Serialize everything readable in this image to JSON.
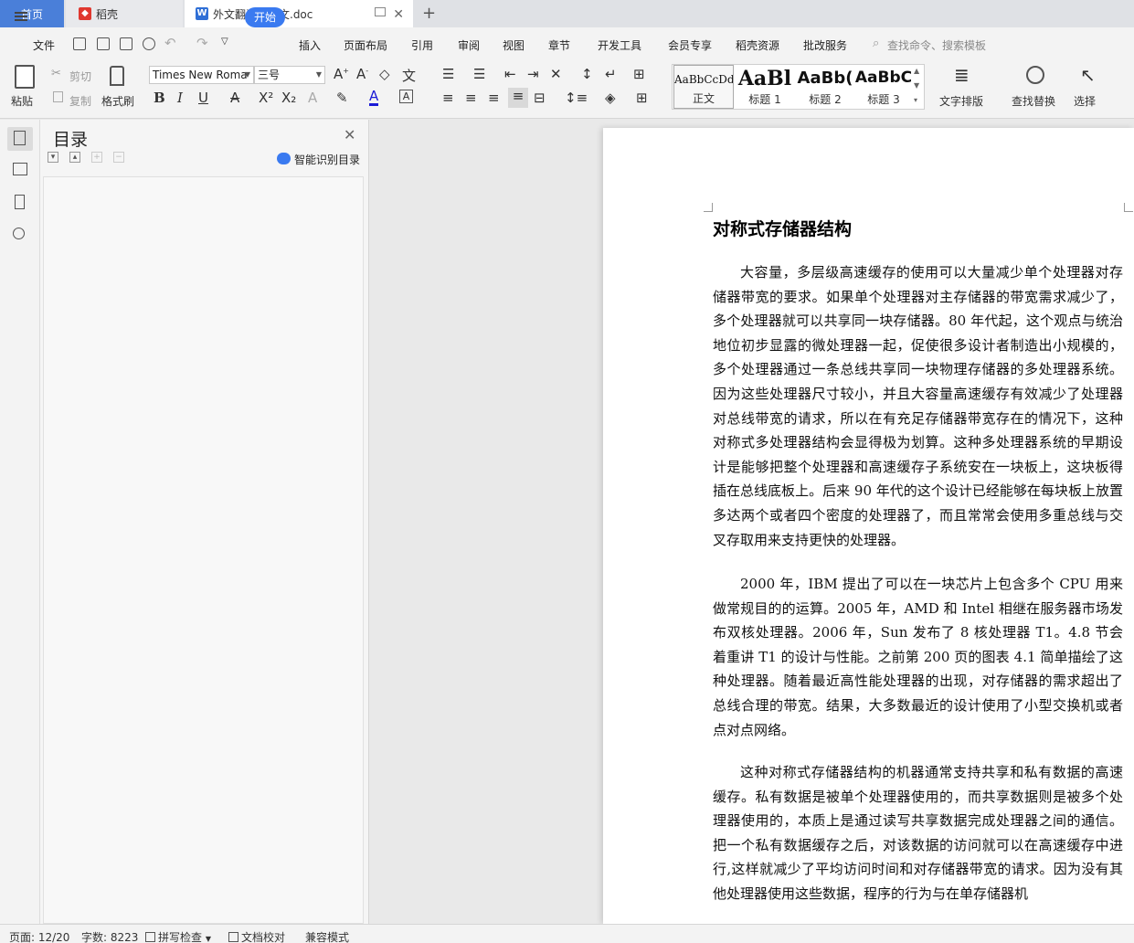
{
  "tabs": {
    "home": "首页",
    "daoke": "稻壳",
    "doc": "外文翻译及原文.doc"
  },
  "menu": {
    "file": "文件",
    "items": [
      "开始",
      "插入",
      "页面布局",
      "引用",
      "审阅",
      "视图",
      "章节",
      "开发工具",
      "会员专享",
      "稻壳资源",
      "批改服务"
    ],
    "search_placeholder": "查找命令、搜索模板"
  },
  "ribbon": {
    "paste": "粘贴",
    "cut": "剪切",
    "copy": "复制",
    "format_painter": "格式刷",
    "font_name": "Times New Roma",
    "font_size": "三号",
    "styles": [
      {
        "preview": "AaBbCcDd",
        "label": "正文"
      },
      {
        "preview": "AaBl",
        "label": "标题 1"
      },
      {
        "preview": "AaBb(",
        "label": "标题 2"
      },
      {
        "preview": "AaBbC",
        "label": "标题 3"
      }
    ],
    "text_layout": "文字排版",
    "find_replace": "查找替换",
    "select": "选择"
  },
  "toc": {
    "title": "目录",
    "smart_label": "智能识别目录"
  },
  "document": {
    "title": "对称式存储器结构",
    "paragraphs": [
      "大容量，多层级高速缓存的使用可以大量减少单个处理器对存储器带宽的要求。如果单个处理器对主存储器的带宽需求减少了，多个处理器就可以共享同一块存储器。80 年代起，这个观点与统治地位初步显露的微处理器一起，促使很多设计者制造出小规模的，多个处理器通过一条总线共享同一块物理存储器的多处理器系统。因为这些处理器尺寸较小，并且大容量高速缓存有效减少了处理器对总线带宽的请求，所以在有充足存储器带宽存在的情况下，这种对称式多处理器结构会显得极为划算。这种多处理器系统的早期设计是能够把整个处理器和高速缓存子系统安在一块板上，这块板得插在总线底板上。后来 90 年代的这个设计已经能够在每块板上放置多达两个或者四个密度的处理器了，而且常常会使用多重总线与交叉存取用来支持更快的处理器。",
      "2000 年，IBM 提出了可以在一块芯片上包含多个 CPU 用来做常规目的的运算。2005 年，AMD 和 Intel 相继在服务器市场发布双核处理器。2006 年，Sun 发布了 8 核处理器 T1。4.8 节会着重讲 T1 的设计与性能。之前第 200 页的图表 4.1 简单描绘了这种处理器。随着最近高性能处理器的出现，对存储器的需求超出了总线合理的带宽。结果，大多数最近的设计使用了小型交换机或者点对点网络。",
      "这种对称式存储器结构的机器通常支持共享和私有数据的高速缓存。私有数据是被单个处理器使用的，而共享数据则是被多个处理器使用的，本质上是通过读写共享数据完成处理器之间的通信。把一个私有数据缓存之后，对该数据的访问就可以在高速缓存中进行,这样就减少了平均访问时间和对存储器带宽的请求。因为没有其他处理器使用这些数据，程序的行为与在单存储器机"
    ]
  },
  "status": {
    "page": "页面: 12/20",
    "word_count": "字数: 8223",
    "spell_check": "拼写检查",
    "doc_proof": "文档校对",
    "compat_mode": "兼容模式"
  },
  "colors": {
    "accent": "#3a7af0",
    "home_tab": "#4a7fd9",
    "daoke_logo": "#e0382f",
    "doc_logo": "#2f6fd6"
  }
}
